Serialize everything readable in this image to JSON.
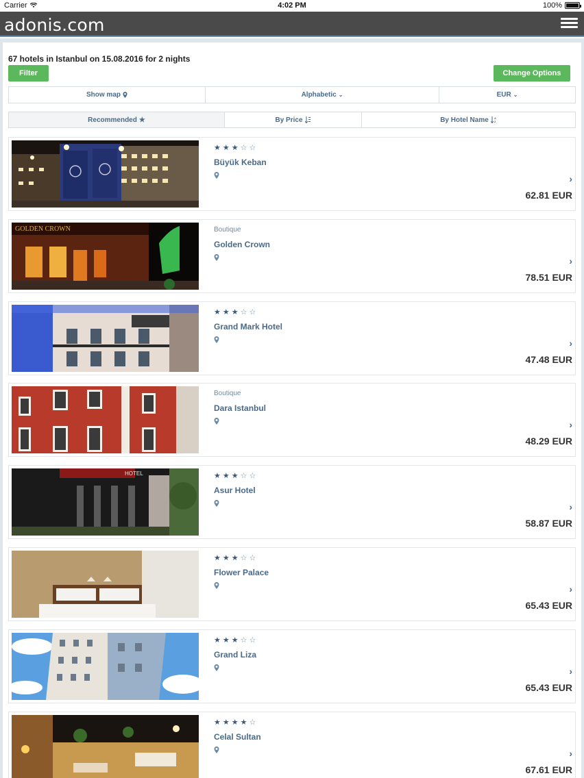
{
  "status_bar": {
    "carrier": "Carrier",
    "time": "4:02 PM",
    "battery": "100%"
  },
  "navbar": {
    "logo": "adonis.com"
  },
  "summary": "67 hotels in Istanbul on 15.08.2016 for 2 nights",
  "buttons": {
    "filter": "Filter",
    "change_options": "Change Options"
  },
  "options_bar": {
    "show_map": "Show map",
    "sort_mode": "Alphabetic",
    "currency": "EUR"
  },
  "sort_tabs": {
    "recommended": "Recommended",
    "by_price": "By Price",
    "by_hotel_name": "By Hotel Name"
  },
  "hotels": [
    {
      "name": "Büyük Keban",
      "stars": 3,
      "category": "",
      "price": "62.81 EUR"
    },
    {
      "name": "Golden Crown",
      "stars": 0,
      "category": "Boutique",
      "price": "78.51 EUR"
    },
    {
      "name": "Grand Mark Hotel",
      "stars": 3,
      "category": "",
      "price": "47.48 EUR"
    },
    {
      "name": "Dara Istanbul",
      "stars": 0,
      "category": "Boutique",
      "price": "48.29 EUR"
    },
    {
      "name": "Asur Hotel",
      "stars": 3,
      "category": "",
      "price": "58.87 EUR"
    },
    {
      "name": "Flower Palace",
      "stars": 3,
      "category": "",
      "price": "65.43 EUR"
    },
    {
      "name": "Grand Liza",
      "stars": 3,
      "category": "",
      "price": "65.43 EUR"
    },
    {
      "name": "Celal Sultan",
      "stars": 4,
      "category": "",
      "price": "67.61 EUR"
    }
  ],
  "colors": {
    "accent_green": "#5cb85c",
    "navbar": "#4a4a4a",
    "link_blue": "#4a6a8a"
  }
}
